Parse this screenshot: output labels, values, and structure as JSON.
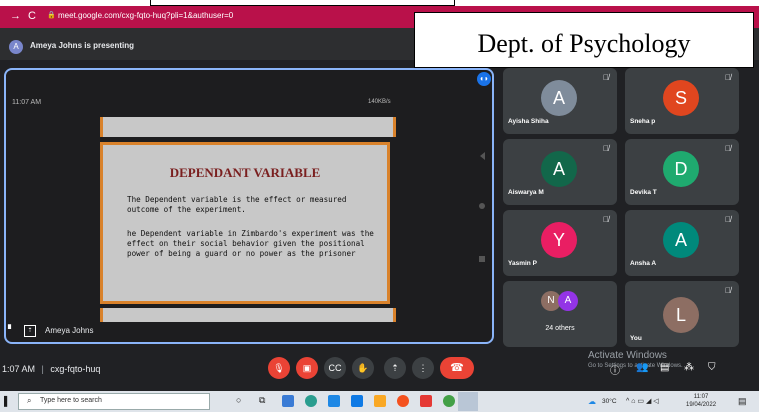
{
  "browser": {
    "url": "meet.google.com/cxg-fqto-huq?pli=1&authuser=0"
  },
  "presenting": {
    "avatar_letter": "A",
    "text": "Ameya Johns is presenting"
  },
  "overlay": {
    "department": "Dept. of Psychology"
  },
  "phone": {
    "time": "11:07 AM",
    "status": "140KB/s"
  },
  "slide": {
    "title": "DEPENDANT VARIABLE",
    "para1": "The Dependent variable is the effect or measured outcome of the experiment.",
    "para2": "he Dependent variable in Zimbardo's experiment was the effect on their social behavior given the positional power of being a guard or no power as the prisoner"
  },
  "presenter_name": "Ameya Johns",
  "participants": [
    {
      "letter": "A",
      "name": "Ayisha Shiha",
      "color": "#7f8c9b"
    },
    {
      "letter": "S",
      "name": "Sneha p",
      "color": "#e0461f"
    },
    {
      "letter": "A",
      "name": "Aiswarya M",
      "color": "#12674a"
    },
    {
      "letter": "D",
      "name": "Devika T",
      "color": "#1faa6f"
    },
    {
      "letter": "Y",
      "name": "Yasmin P",
      "color": "#e91e63"
    },
    {
      "letter": "A",
      "name": "Ansha A",
      "color": "#00897b"
    },
    {
      "letter": "N A",
      "name": "24 others",
      "color": "#8d6e63"
    },
    {
      "letter": "L",
      "name": "You",
      "color": "#8d6e63"
    }
  ],
  "meeting": {
    "time": "1:07 AM",
    "separator": "|",
    "code": "cxg-fqto-huq"
  },
  "windows": {
    "activate_title": "Activate Windows",
    "activate_sub": "Go to Settings to activate Windows."
  },
  "taskbar": {
    "search_placeholder": "Type here to search",
    "weather": "30°C",
    "time": "11:07",
    "date": "19/04/2022"
  }
}
